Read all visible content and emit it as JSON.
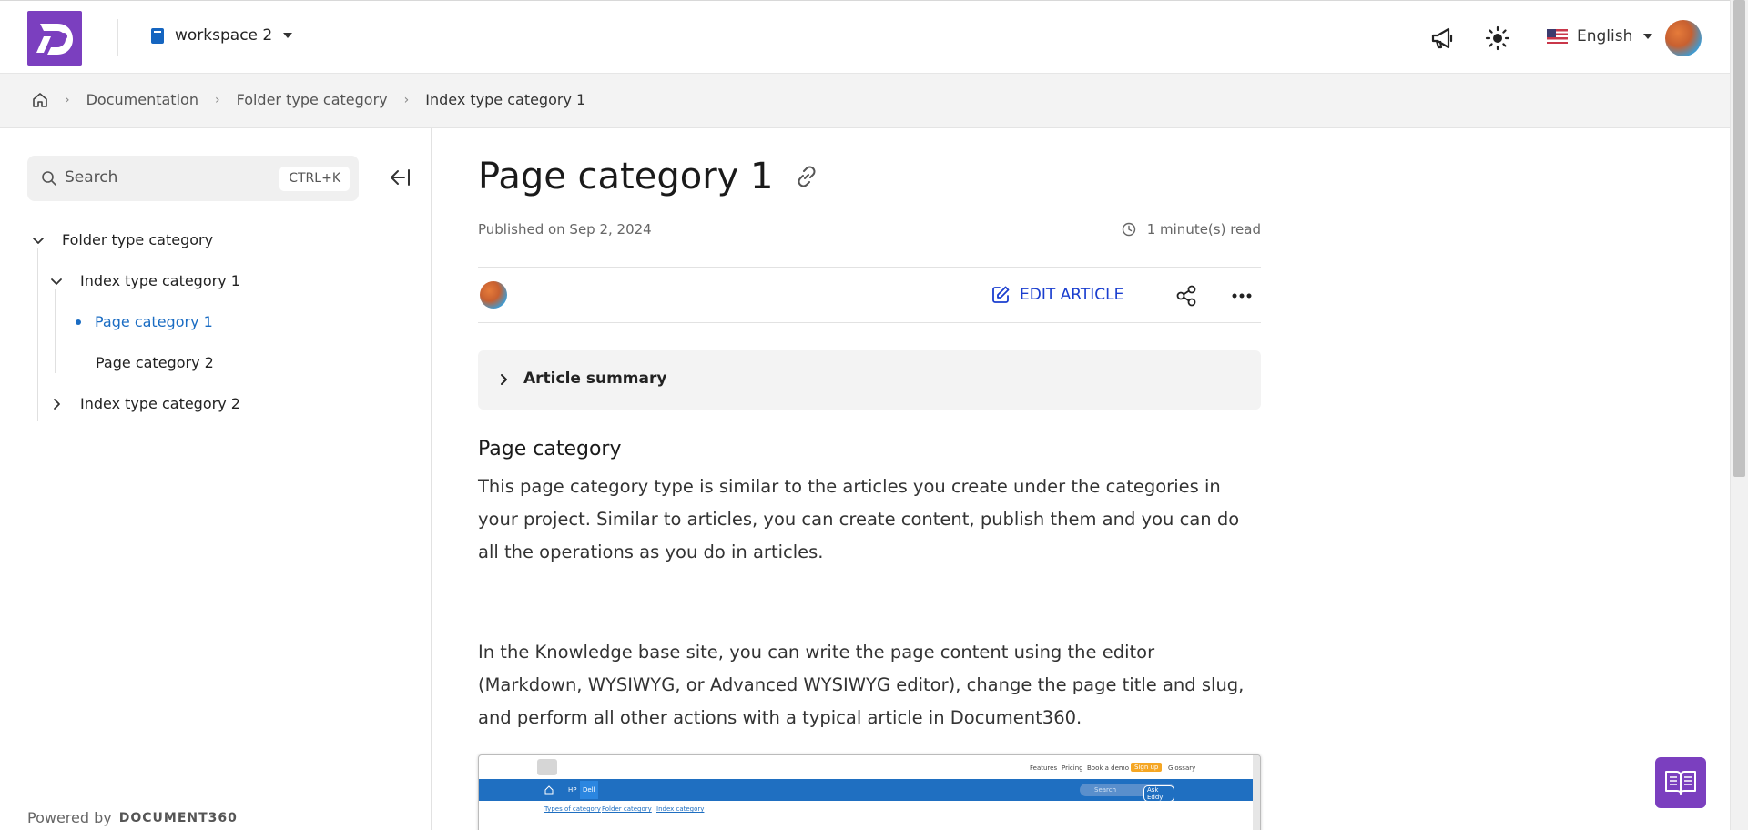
{
  "header": {
    "workspace": "workspace 2",
    "language": "English"
  },
  "breadcrumb": {
    "items": [
      "Documentation",
      "Folder type category",
      "Index type category 1"
    ]
  },
  "sidebar": {
    "search_placeholder": "Search",
    "search_shortcut": "CTRL+K",
    "tree": {
      "folder": "Folder type category",
      "index1": "Index type category 1",
      "page1": "Page category 1",
      "page2": "Page category 2",
      "index2": "Index type category 2"
    },
    "powered_by": "Powered by",
    "brand": "DOCUMENT360"
  },
  "article": {
    "title": "Page category 1",
    "published": "Published on Sep 2, 2024",
    "read_time": "1 minute(s) read",
    "edit_label": "EDIT ARTICLE",
    "summary_label": "Article summary",
    "heading": "Page category",
    "para1": "This page category type is similar to the articles you create under the categories in your project. Similar to articles, you can create content, publish them and you can do all the operations as you do in articles.",
    "para2": "In the Knowledge base site, you can write the page content using the editor (Markdown, WYSIWYG, or Advanced WYSIWYG editor), change the page title and slug, and perform all other actions with a typical article in Document360."
  },
  "screenshot_preview": {
    "nav": [
      "Features",
      "Pricing",
      "Book a demo",
      "Sign up",
      "Glossary"
    ],
    "tabs": [
      "HP",
      "Dell"
    ],
    "search": "Search",
    "ask": "Ask Eddy",
    "crumbs": [
      "Types of category",
      "Folder category",
      "Index category"
    ]
  },
  "colors": {
    "brand": "#7b3fbf",
    "link": "#1a6cc3",
    "edit": "#1a3ecf"
  }
}
